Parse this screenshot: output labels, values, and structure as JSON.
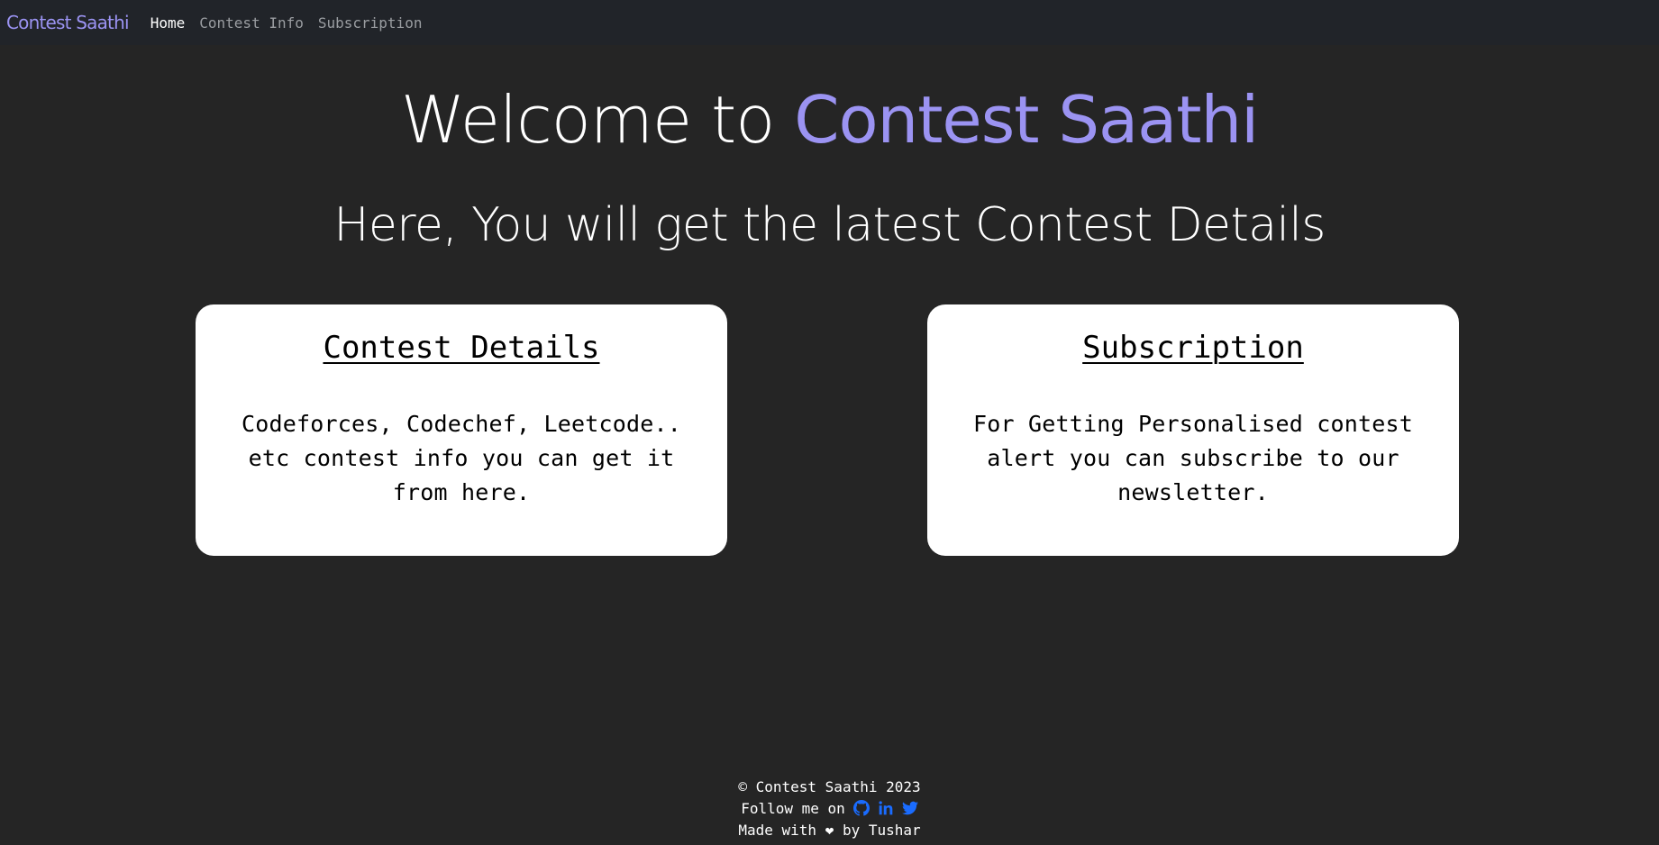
{
  "navbar": {
    "brand": "Contest Saathi",
    "links": [
      {
        "label": "Home",
        "active": true
      },
      {
        "label": "Contest Info",
        "active": false
      },
      {
        "label": "Subscription",
        "active": false
      }
    ]
  },
  "hero": {
    "title_prefix": "Welcome to ",
    "title_accent": "Contest Saathi",
    "subtitle": "Here, You will get the latest Contest Details"
  },
  "cards": [
    {
      "title": "Contest Details",
      "text": "Codeforces, Codechef, Leetcode.. etc contest info you can get it from here."
    },
    {
      "title": "Subscription",
      "text": "For Getting Personalised contest alert you can subscribe to our newsletter."
    }
  ],
  "footer": {
    "copyright": "© Contest Saathi 2023",
    "follow": "Follow me on",
    "made_with_prefix": "Made with",
    "heart": "❤",
    "made_with_suffix": "by Tushar",
    "social_icons": [
      "github-icon",
      "linkedin-icon",
      "twitter-icon"
    ]
  },
  "colors": {
    "background": "#252525",
    "navbar": "#212429",
    "accent": "#9b93f2",
    "social": "#1a6cff"
  }
}
